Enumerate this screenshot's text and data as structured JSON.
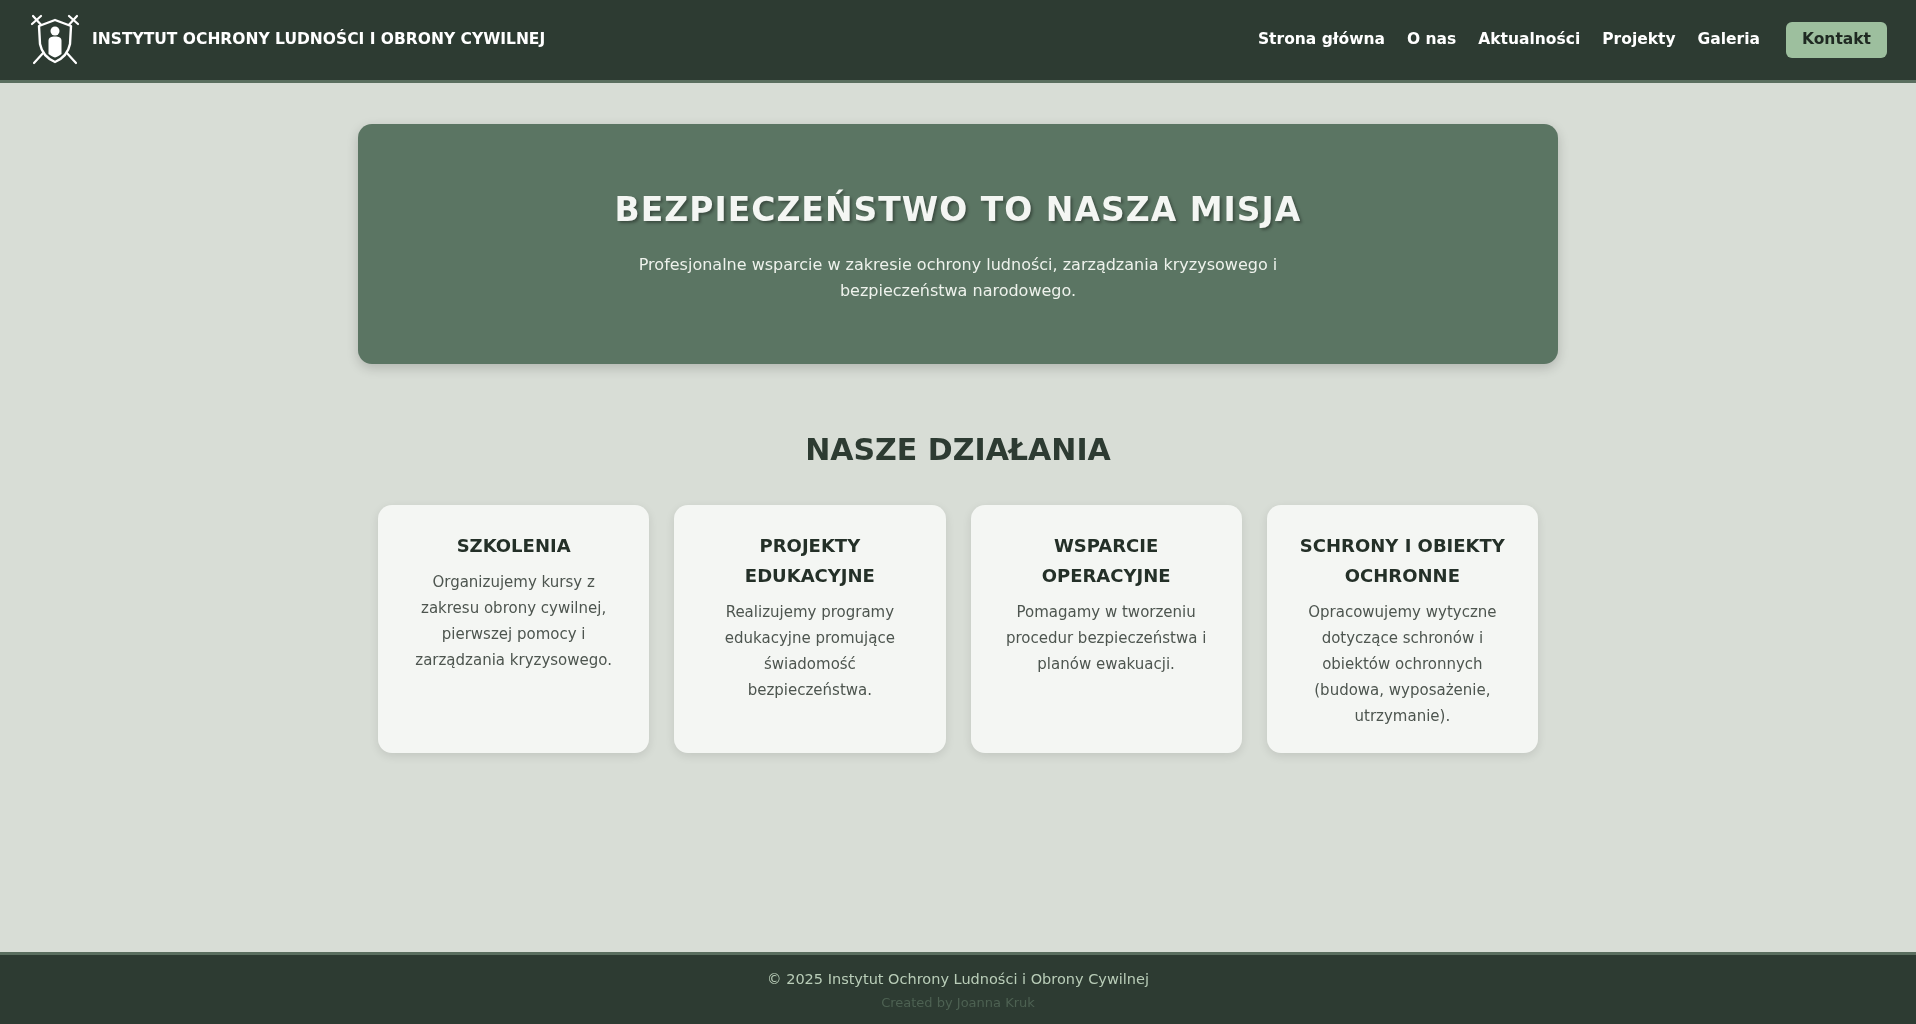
{
  "header": {
    "title": "INSTYTUT OCHRONY LUDNOŚCI I OBRONY CYWILNEJ",
    "nav": [
      {
        "label": "Strona główna",
        "kind": "link"
      },
      {
        "label": "O nas",
        "kind": "link"
      },
      {
        "label": "Aktualności",
        "kind": "link"
      },
      {
        "label": "Projekty",
        "kind": "link"
      },
      {
        "label": "Galeria",
        "kind": "link"
      },
      {
        "label": "Kontakt",
        "kind": "button"
      }
    ]
  },
  "hero": {
    "title": "BEZPIECZEŃSTWO TO NASZA MISJA",
    "subtitle": "Profesjonalne wsparcie w zakresie ochrony ludności, zarządzania kryzysowego i bezpieczeństwa narodowego."
  },
  "activities": {
    "heading": "NASZE DZIAŁANIA",
    "cards": [
      {
        "title": "SZKOLENIA",
        "text": "Organizujemy kursy z zakresu obrony cywilnej, pierwszej pomocy i zarządzania kryzysowego."
      },
      {
        "title": "PROJEKTY EDUKACYJNE",
        "text": "Realizujemy programy edukacyjne promujące świadomość bezpieczeństwa."
      },
      {
        "title": "WSPARCIE OPERACYJNE",
        "text": "Pomagamy w tworzeniu procedur bezpieczeństwa i planów ewakuacji."
      },
      {
        "title": "SCHRONY I OBIEKTY OCHRONNE",
        "text": "Opracowujemy wytyczne dotyczące schronów i obiektów ochronnych (budowa, wyposażenie, utrzymanie)."
      }
    ]
  },
  "footer": {
    "copyright": "© 2025 Instytut Ochrony Ludności i Obrony Cywilnej",
    "credit": "Created by Joanna Kruk"
  }
}
